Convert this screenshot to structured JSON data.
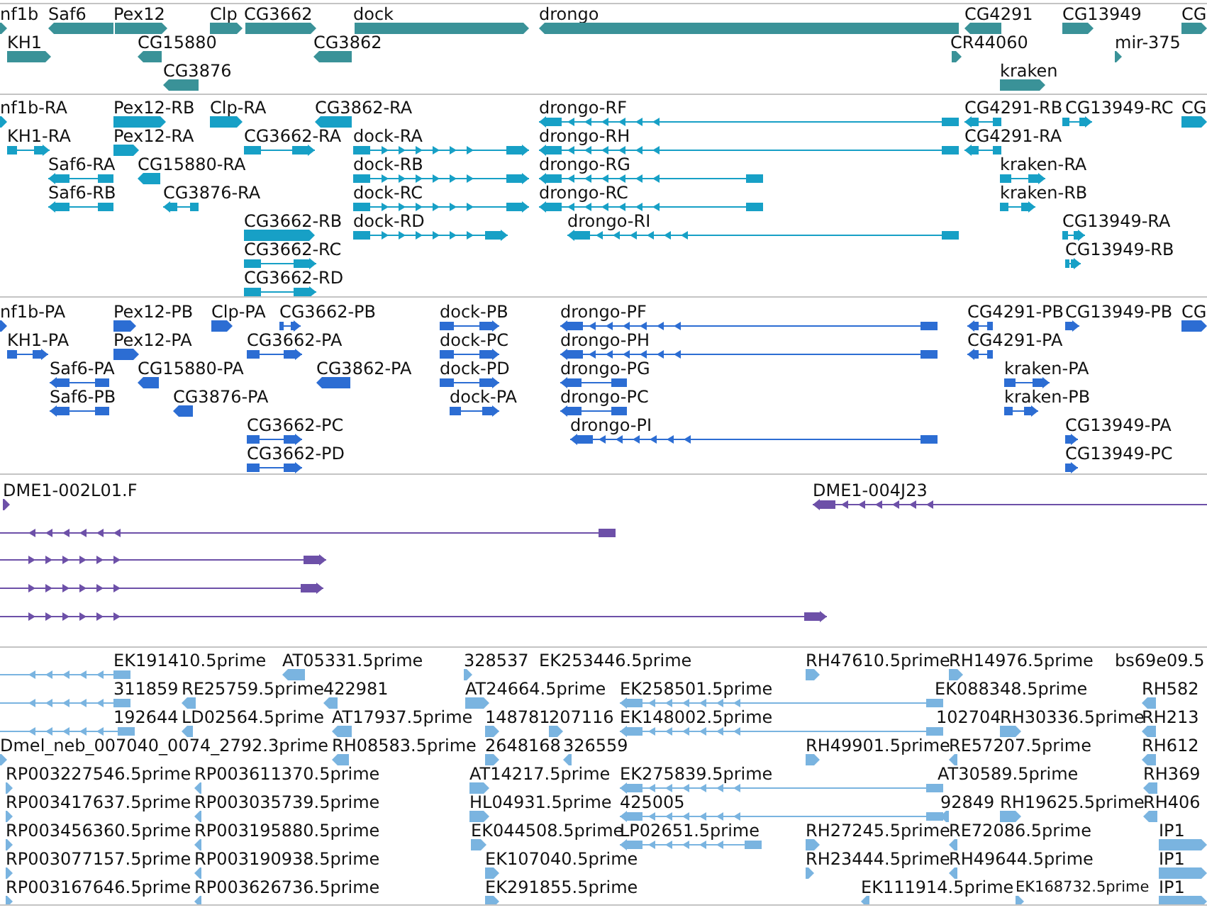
{
  "tracks": [
    {
      "color": "#3a9298",
      "features": [
        {
          "label": "nf1b",
          "reverse": false
        },
        {
          "label": "Saf6",
          "reverse": true
        },
        {
          "label": "Pex12",
          "reverse": false
        },
        {
          "label": "Clp",
          "reverse": false
        },
        {
          "label": "CG3662",
          "reverse": false
        },
        {
          "label": "dock",
          "reverse": false
        },
        {
          "label": "drongo",
          "reverse": true
        },
        {
          "label": "CG4291",
          "reverse": true
        },
        {
          "label": "CG13949",
          "reverse": false
        },
        {
          "label": "CG",
          "reverse": false
        },
        {
          "label": "KH1",
          "reverse": false
        },
        {
          "label": "CG15880",
          "reverse": true
        },
        {
          "label": "CG3862",
          "reverse": true
        },
        {
          "label": "CR44060",
          "reverse": false
        },
        {
          "label": "mir-375",
          "reverse": false
        },
        {
          "label": "CG3876",
          "reverse": true
        },
        {
          "label": "kraken",
          "reverse": false
        }
      ]
    },
    {
      "color": "#17a0c6",
      "features": [
        {
          "label": "nf1b-RA",
          "reverse": false
        },
        {
          "label": "Pex12-RB",
          "reverse": false
        },
        {
          "label": "Clp-RA",
          "reverse": false
        },
        {
          "label": "CG3862-RA",
          "reverse": true
        },
        {
          "label": "drongo-RF",
          "reverse": true
        },
        {
          "label": "CG4291-RB",
          "reverse": true
        },
        {
          "label": "CG13949-RC",
          "reverse": false
        },
        {
          "label": "CG",
          "reverse": false
        },
        {
          "label": "KH1-RA",
          "reverse": false
        },
        {
          "label": "Pex12-RA",
          "reverse": false
        },
        {
          "label": "CG3662-RA",
          "reverse": false
        },
        {
          "label": "dock-RA",
          "reverse": false
        },
        {
          "label": "drongo-RH",
          "reverse": true
        },
        {
          "label": "CG4291-RA",
          "reverse": true
        },
        {
          "label": "Saf6-RA",
          "reverse": true
        },
        {
          "label": "CG15880-RA",
          "reverse": true
        },
        {
          "label": "dock-RB",
          "reverse": false
        },
        {
          "label": "drongo-RG",
          "reverse": true
        },
        {
          "label": "kraken-RA",
          "reverse": false
        },
        {
          "label": "Saf6-RB",
          "reverse": true
        },
        {
          "label": "CG3876-RA",
          "reverse": true
        },
        {
          "label": "dock-RC",
          "reverse": false
        },
        {
          "label": "drongo-RC",
          "reverse": true
        },
        {
          "label": "kraken-RB",
          "reverse": false
        },
        {
          "label": "CG3662-RB",
          "reverse": false
        },
        {
          "label": "dock-RD",
          "reverse": false
        },
        {
          "label": "drongo-RI",
          "reverse": true
        },
        {
          "label": "CG13949-RA",
          "reverse": false
        },
        {
          "label": "CG3662-RC",
          "reverse": false
        },
        {
          "label": "CG13949-RB",
          "reverse": false
        },
        {
          "label": "CG3662-RD",
          "reverse": false
        }
      ]
    },
    {
      "color": "#2c6dd3",
      "features": [
        {
          "label": "nf1b-PA",
          "reverse": false
        },
        {
          "label": "Pex12-PB",
          "reverse": false
        },
        {
          "label": "Clp-PA",
          "reverse": false
        },
        {
          "label": "CG3662-PB",
          "reverse": false
        },
        {
          "label": "dock-PB",
          "reverse": false
        },
        {
          "label": "drongo-PF",
          "reverse": true
        },
        {
          "label": "CG4291-PB",
          "reverse": true
        },
        {
          "label": "CG13949-PB",
          "reverse": false
        },
        {
          "label": "CG",
          "reverse": false
        },
        {
          "label": "KH1-PA",
          "reverse": false
        },
        {
          "label": "Pex12-PA",
          "reverse": false
        },
        {
          "label": "CG3662-PA",
          "reverse": false
        },
        {
          "label": "dock-PC",
          "reverse": false
        },
        {
          "label": "drongo-PH",
          "reverse": true
        },
        {
          "label": "CG4291-PA",
          "reverse": true
        },
        {
          "label": "Saf6-PA",
          "reverse": true
        },
        {
          "label": "CG15880-PA",
          "reverse": true
        },
        {
          "label": "CG3862-PA",
          "reverse": true
        },
        {
          "label": "dock-PD",
          "reverse": false
        },
        {
          "label": "drongo-PG",
          "reverse": true
        },
        {
          "label": "kraken-PA",
          "reverse": false
        },
        {
          "label": "Saf6-PB",
          "reverse": true
        },
        {
          "label": "CG3876-PA",
          "reverse": true
        },
        {
          "label": "dock-PA",
          "reverse": false
        },
        {
          "label": "drongo-PC",
          "reverse": true
        },
        {
          "label": "kraken-PB",
          "reverse": false
        },
        {
          "label": "CG3662-PC",
          "reverse": false
        },
        {
          "label": "drongo-PI",
          "reverse": true
        },
        {
          "label": "CG13949-PA",
          "reverse": false
        },
        {
          "label": "CG3662-PD",
          "reverse": false
        },
        {
          "label": "CG13949-PC",
          "reverse": false
        }
      ]
    },
    {
      "color": "#6d50a8",
      "features": [
        {
          "label": "DME1-002L01.F",
          "reverse": false
        },
        {
          "label": "DME1-004J23",
          "reverse": true
        },
        {
          "reverse": true
        },
        {
          "reverse": false
        },
        {
          "reverse": false
        },
        {
          "reverse": false
        }
      ]
    },
    {
      "color": "#7ab4e0",
      "features": [
        {
          "label": "EK191410.5prime",
          "reverse": true
        },
        {
          "label": "AT05331.5prime",
          "reverse": true
        },
        {
          "label": "328537",
          "reverse": false
        },
        {
          "label": "EK253446.5prime"
        },
        {
          "label": "RH47610.5prime",
          "reverse": false
        },
        {
          "label": "RH14976.5prime",
          "reverse": false
        },
        {
          "label": "bs69e09.5"
        },
        {
          "label": "311859",
          "reverse": true
        },
        {
          "label": "RE25759.5prime",
          "reverse": true
        },
        {
          "label": "422981",
          "reverse": true
        },
        {
          "label": "AT24664.5prime",
          "reverse": false
        },
        {
          "label": "EK258501.5prime",
          "reverse": true
        },
        {
          "label": "EK088348.5prime"
        },
        {
          "label": "RH582",
          "reverse": true
        },
        {
          "label": "192644",
          "reverse": true
        },
        {
          "label": "LD02564.5prime",
          "reverse": true
        },
        {
          "label": "AT17937.5prime",
          "reverse": true
        },
        {
          "label": "148781",
          "reverse": false
        },
        {
          "label": "207116",
          "reverse": false
        },
        {
          "label": "EK148002.5prime",
          "reverse": true
        },
        {
          "label": "102704"
        },
        {
          "label": "RH30336.5prime",
          "reverse": false
        },
        {
          "label": "RH213",
          "reverse": true
        },
        {
          "label": "Dmel_neb_007040_0074_2792.3prime",
          "reverse": false
        },
        {
          "label": "RH08583.5prime",
          "reverse": true
        },
        {
          "label": "2648168",
          "reverse": false
        },
        {
          "label": "326559",
          "reverse": true
        },
        {
          "label": "RH49901.5prime",
          "reverse": false
        },
        {
          "label": "RE57207.5prime",
          "reverse": true
        },
        {
          "label": "RH612",
          "reverse": true
        },
        {
          "label": "RP003227546.5prime",
          "reverse": false
        },
        {
          "label": "RP003611370.5prime",
          "reverse": true
        },
        {
          "label": "AT14217.5prime",
          "reverse": false
        },
        {
          "label": "EK275839.5prime",
          "reverse": true
        },
        {
          "label": "AT30589.5prime"
        },
        {
          "label": "RH369",
          "reverse": true
        },
        {
          "label": "RP003417637.5prime",
          "reverse": false
        },
        {
          "label": "RP003035739.5prime",
          "reverse": true
        },
        {
          "label": "HL04931.5prime",
          "reverse": false
        },
        {
          "label": "425005",
          "reverse": true
        },
        {
          "label": "92849",
          "reverse": true
        },
        {
          "label": "RH19625.5prime",
          "reverse": false
        },
        {
          "label": "RH406",
          "reverse": true
        },
        {
          "label": "RP003456360.5prime",
          "reverse": false
        },
        {
          "label": "RP003195880.5prime",
          "reverse": true
        },
        {
          "label": "EK044508.5prime",
          "reverse": false
        },
        {
          "label": "LP02651.5prime",
          "reverse": true
        },
        {
          "label": "RH27245.5prime",
          "reverse": false
        },
        {
          "label": "RE72086.5prime",
          "reverse": true
        },
        {
          "label": "IP1",
          "reverse": false
        },
        {
          "label": "RP003077157.5prime",
          "reverse": false
        },
        {
          "label": "RP003190938.5prime",
          "reverse": true
        },
        {
          "label": "EK107040.5prime",
          "reverse": false
        },
        {
          "label": "RH23444.5prime",
          "reverse": false
        },
        {
          "label": "RH49644.5prime",
          "reverse": true
        },
        {
          "label": "IP1",
          "reverse": false
        },
        {
          "label": "RP003167646.5prime",
          "reverse": false
        },
        {
          "label": "RP003626736.5prime",
          "reverse": true
        },
        {
          "label": "EK291855.5prime",
          "reverse": false
        },
        {
          "label": "EK111914.5prime",
          "reverse": true
        },
        {
          "label": "EK168732.5prime",
          "reverse": false
        },
        {
          "label": "IP1",
          "reverse": false
        }
      ]
    }
  ]
}
